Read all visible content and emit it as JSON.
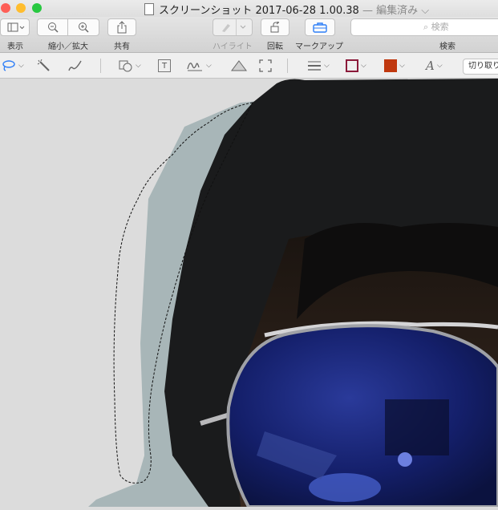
{
  "window": {
    "title": "スクリーンショット 2017-06-28 1.00.38",
    "status": "— 編集済み ⌵",
    "traffic_lights": {
      "close": "#fe5f57",
      "minimize": "#ffbd2e",
      "zoom": "#28c840"
    }
  },
  "toolbar": {
    "view_label": "表示",
    "zoom_label": "縮小／拡大",
    "share_label": "共有",
    "highlight_label": "ハイライト",
    "rotate_label": "回転",
    "markup_label": "マークアップ",
    "search_placeholder": "検索",
    "search_label": "検索"
  },
  "markup_toolbar": {
    "crop_label": "切り取り",
    "stroke_color": "#8b1a3a",
    "fill_color": "#c0380f",
    "font_icon_text": "A",
    "text_box_glyph": "T"
  },
  "canvas": {
    "description_icon": "photo-sunglasses-hood",
    "selection_mode": "lasso"
  }
}
